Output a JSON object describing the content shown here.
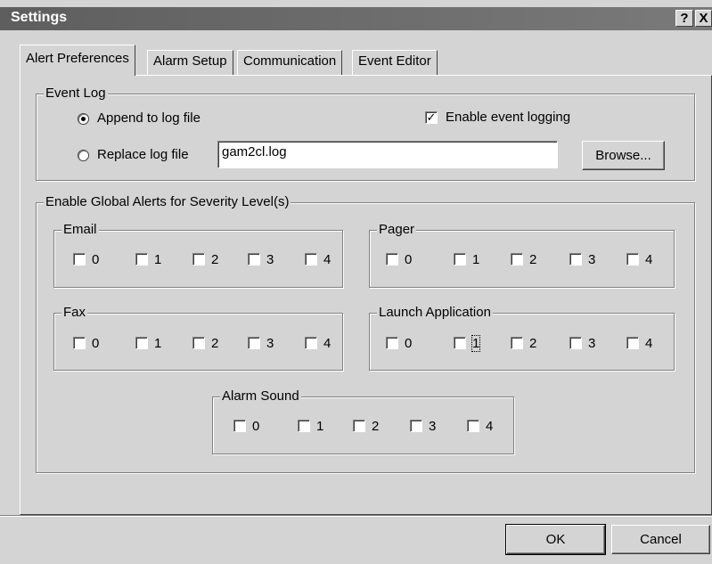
{
  "window": {
    "title": "Settings",
    "help_glyph": "?",
    "close_glyph": "X"
  },
  "tabs": [
    {
      "label": "Alert Preferences",
      "active": true
    },
    {
      "label": "Alarm Setup",
      "active": false
    },
    {
      "label": "Communication",
      "active": false
    },
    {
      "label": "Event Editor",
      "active": false
    }
  ],
  "event_log": {
    "legend": "Event Log",
    "append_label": "Append to log file",
    "replace_label": "Replace log file",
    "append_selected": true,
    "enable_label": "Enable event logging",
    "enable_checked": true,
    "check_glyph": "✓",
    "filename": "gam2cl.log",
    "browse_label": "Browse..."
  },
  "global_alerts": {
    "legend": "Enable Global Alerts for Severity Level(s)",
    "levels": [
      "0",
      "1",
      "2",
      "3",
      "4"
    ],
    "email": {
      "legend": "Email"
    },
    "pager": {
      "legend": "Pager"
    },
    "fax": {
      "legend": "Fax"
    },
    "launch": {
      "legend": "Launch Application"
    },
    "alarm": {
      "legend": "Alarm Sound"
    }
  },
  "buttons": {
    "ok": "OK",
    "cancel": "Cancel"
  }
}
